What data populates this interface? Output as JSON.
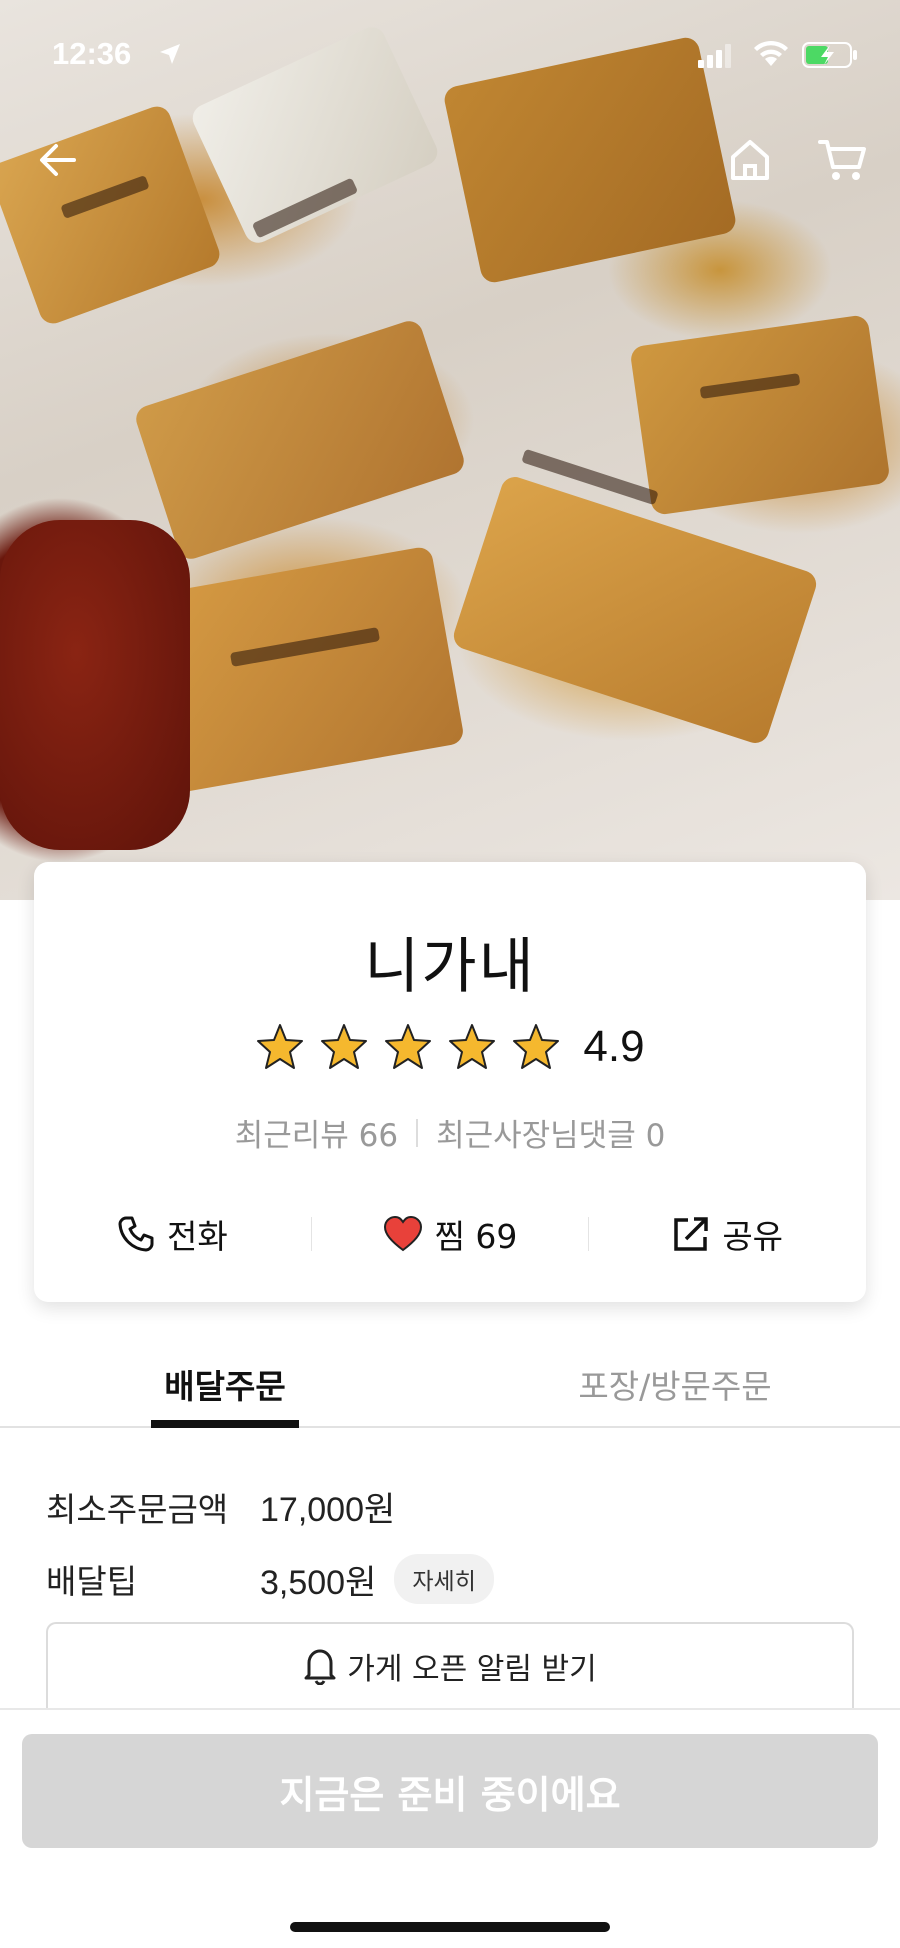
{
  "status_bar": {
    "time": "12:36"
  },
  "store": {
    "name": "니가내",
    "rating": "4.9",
    "recent_reviews": "최근리뷰 66",
    "owner_replies": "최근사장님댓글 0"
  },
  "actions": {
    "call": "전화",
    "favorite": "찜 69",
    "share": "공유"
  },
  "tabs": [
    {
      "label": "배달주문",
      "active": true
    },
    {
      "label": "포장/방문주문",
      "active": false
    }
  ],
  "info": {
    "min_order_label": "최소주문금액",
    "min_order_value": "17,000원",
    "delivery_tip_label": "배달팁",
    "delivery_tip_value": "3,500원",
    "detail_label": "자세히"
  },
  "notify_button": "가게 오픈 알림 받기",
  "cta_button": "지금은 준비 중이에요",
  "colors": {
    "star": "#f5b82e",
    "heart": "#e8413a",
    "cta_disabled": "#d6d6d6"
  }
}
